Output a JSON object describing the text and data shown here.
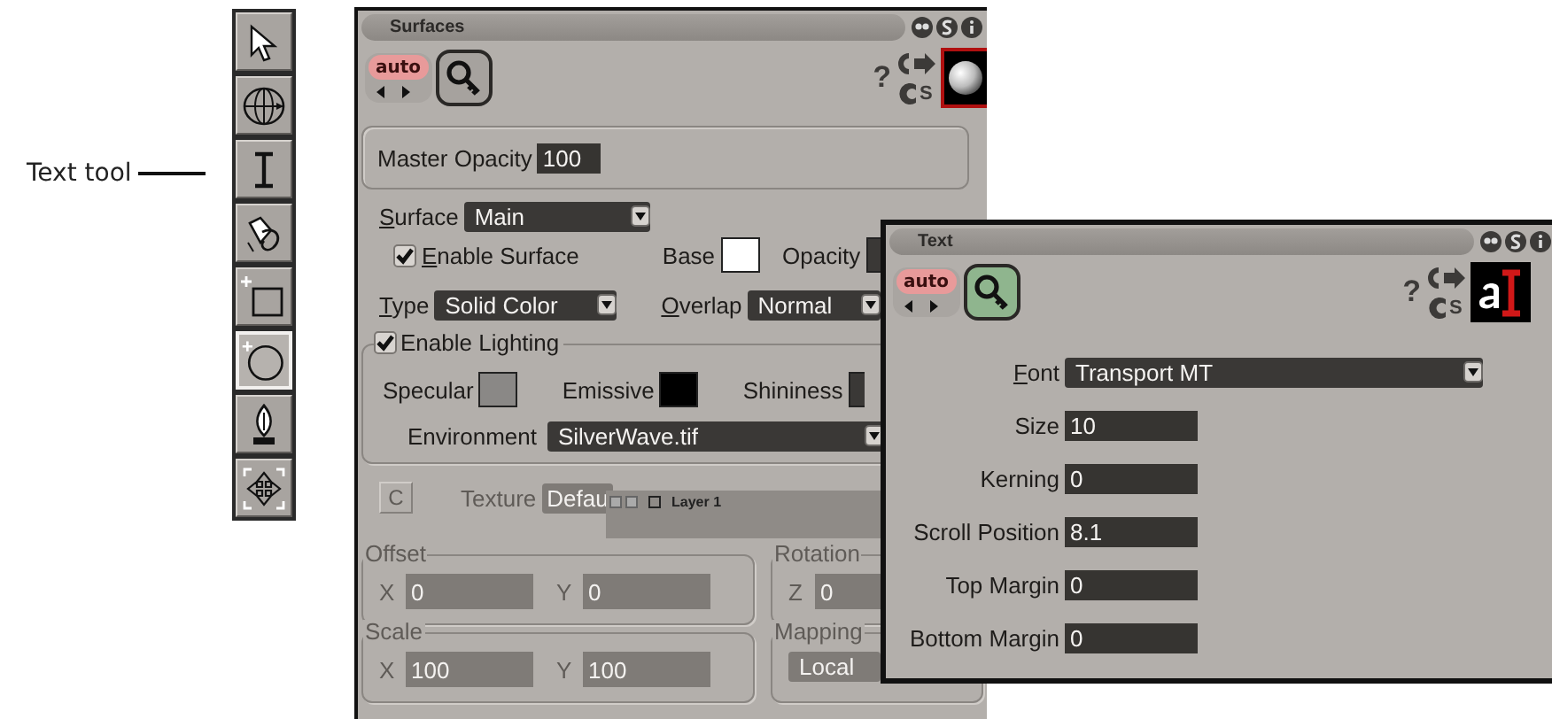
{
  "callout": {
    "label": "Text tool"
  },
  "toolbar": {
    "tools": [
      {
        "kind": "arrow",
        "selected": false
      },
      {
        "kind": "orbit",
        "selected": false
      },
      {
        "kind": "text",
        "selected": false
      },
      {
        "kind": "light",
        "selected": false
      },
      {
        "kind": "rect",
        "selected": false
      },
      {
        "kind": "circle",
        "selected": true
      },
      {
        "kind": "pen",
        "selected": false
      },
      {
        "kind": "transform",
        "selected": false
      }
    ]
  },
  "surfaces": {
    "title": "Surfaces",
    "auto": "auto",
    "key_active": false,
    "help": "?",
    "store": "S",
    "master_opacity": {
      "label": "Master Opacity",
      "value": "100"
    },
    "surface": {
      "label": "Surface",
      "underlined": true,
      "value": "Main"
    },
    "enable_surface": {
      "label": "Enable Surface",
      "underlined": true,
      "checked": true
    },
    "base": {
      "label": "Base",
      "color": "#ffffff"
    },
    "opacity": {
      "label": "Opacity",
      "color": "#3a3836"
    },
    "type": {
      "label": "Type",
      "underlined": true,
      "value": "Solid Color"
    },
    "overlap": {
      "label": "Overlap",
      "underlined": true,
      "value": "Normal"
    },
    "enable_lighting": {
      "label": "Enable Lighting",
      "underlined": false,
      "checked": true
    },
    "specular": {
      "label": "Specular",
      "color": "#8a8886"
    },
    "emissive": {
      "label": "Emissive",
      "color": "#000000"
    },
    "shininess": {
      "label": "Shininess",
      "color": "#3a3836"
    },
    "environment": {
      "label": "Environment",
      "value": "SilverWave.tif"
    },
    "texture_button": {
      "label": "C",
      "disabled": true
    },
    "texture": {
      "label": "Texture",
      "value": "Defau",
      "disabled": true
    },
    "offset": {
      "title": "Offset",
      "disabled": true,
      "fields": [
        {
          "label": "X",
          "value": "0"
        },
        {
          "label": "Y",
          "value": "0"
        }
      ]
    },
    "rotation": {
      "title": "Rotation",
      "disabled": true,
      "fields": [
        {
          "label": "Z",
          "value": "0"
        }
      ]
    },
    "scale": {
      "title": "Scale",
      "disabled": true,
      "fields": [
        {
          "label": "X",
          "value": "100"
        },
        {
          "label": "Y",
          "value": "100"
        }
      ]
    },
    "mapping": {
      "title": "Mapping",
      "value": "Local",
      "disabled": true
    }
  },
  "layer_panel": {
    "title": "Layer 1"
  },
  "text_window": {
    "title": "Text",
    "auto": "auto",
    "key_active": true,
    "help": "?",
    "store": "S",
    "font": {
      "label": "Font",
      "underlined": true,
      "value": "Transport MT"
    },
    "fields": [
      {
        "label": "Size",
        "value": "10"
      },
      {
        "label": "Kerning",
        "value": "0"
      },
      {
        "label": "Scroll Position",
        "value": "8.1"
      },
      {
        "label": "Top Margin",
        "value": "0"
      },
      {
        "label": "Bottom Margin",
        "value": "0"
      }
    ]
  }
}
